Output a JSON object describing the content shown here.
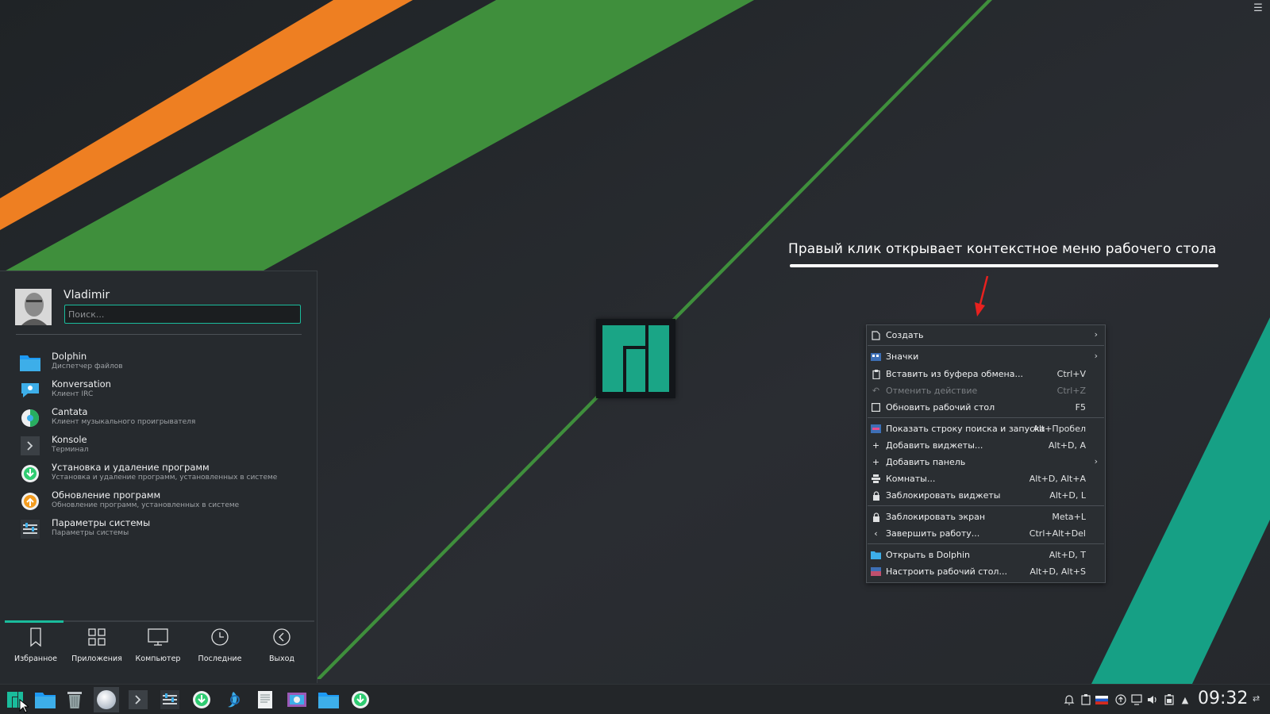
{
  "annotation": {
    "text": "Правый клик открывает контекстное меню рабочего стола"
  },
  "context_menu": {
    "items": [
      {
        "icon": "new-file-icon",
        "label": "Создать",
        "shortcut": "",
        "submenu": true,
        "disabled": false
      },
      {
        "icon": "icons-view-icon",
        "label": "Значки",
        "shortcut": "",
        "submenu": true,
        "disabled": false
      },
      {
        "icon": "clipboard-icon",
        "label": "Вставить из буфера обмена...",
        "shortcut": "Ctrl+V",
        "submenu": false,
        "disabled": false
      },
      {
        "icon": "undo-icon",
        "label": "Отменить действие",
        "shortcut": "Ctrl+Z",
        "submenu": false,
        "disabled": true
      },
      {
        "icon": "refresh-icon",
        "label": "Обновить рабочий стол",
        "shortcut": "F5",
        "submenu": false,
        "disabled": false
      },
      {
        "icon": "krunner-icon",
        "label": "Показать строку поиска и запуска",
        "shortcut": "Alt+Пробел",
        "submenu": false,
        "disabled": false
      },
      {
        "icon": "plus-icon",
        "label": "Добавить виджеты...",
        "shortcut": "Alt+D, A",
        "submenu": false,
        "disabled": false
      },
      {
        "icon": "plus-icon",
        "label": "Добавить панель",
        "shortcut": "",
        "submenu": true,
        "disabled": false
      },
      {
        "icon": "activities-icon",
        "label": "Комнаты...",
        "shortcut": "Alt+D, Alt+A",
        "submenu": false,
        "disabled": false
      },
      {
        "icon": "lock-icon",
        "label": "Заблокировать виджеты",
        "shortcut": "Alt+D, L",
        "submenu": false,
        "disabled": false
      },
      {
        "icon": "lock-icon",
        "label": "Заблокировать экран",
        "shortcut": "Meta+L",
        "submenu": false,
        "disabled": false
      },
      {
        "icon": "chevron-left-icon",
        "label": "Завершить работу...",
        "shortcut": "Ctrl+Alt+Del",
        "submenu": false,
        "disabled": false
      },
      {
        "icon": "folder-icon",
        "label": "Открыть в Dolphin",
        "shortcut": "Alt+D, T",
        "submenu": false,
        "disabled": false
      },
      {
        "icon": "desktop-settings-icon",
        "label": "Настроить рабочий стол...",
        "shortcut": "Alt+D, Alt+S",
        "submenu": false,
        "disabled": false
      }
    ]
  },
  "launcher": {
    "username": "Vladimir",
    "search_placeholder": "Поиск...",
    "favorites": [
      {
        "icon": "folder-icon",
        "name": "Dolphin",
        "description": "Диспетчер файлов"
      },
      {
        "icon": "konversation-icon",
        "name": "Konversation",
        "description": "Клиент IRC"
      },
      {
        "icon": "cantata-icon",
        "name": "Cantata",
        "description": "Клиент музыкального проигрывателя"
      },
      {
        "icon": "terminal-icon",
        "name": "Konsole",
        "description": "Терминал"
      },
      {
        "icon": "software-install-icon",
        "name": "Установка и удаление программ",
        "description": "Установка и удаление программ, установленных в системе"
      },
      {
        "icon": "software-update-icon",
        "name": "Обновление программ",
        "description": "Обновление программ, установленных в системе"
      },
      {
        "icon": "system-settings-icon",
        "name": "Параметры системы",
        "description": "Параметры системы"
      }
    ],
    "tabs": [
      {
        "icon": "bookmark-icon",
        "label": "Избранное",
        "active": true
      },
      {
        "icon": "applications-grid-icon",
        "label": "Приложения",
        "active": false
      },
      {
        "icon": "computer-icon",
        "label": "Компьютер",
        "active": false
      },
      {
        "icon": "history-icon",
        "label": "Последние",
        "active": false
      },
      {
        "icon": "leave-icon",
        "label": "Выход",
        "active": false
      }
    ]
  },
  "panel": {
    "tasks": [
      "manjaro-menu-icon",
      "dolphin-icon",
      "trash-icon",
      "browser-icon",
      "terminal-icon",
      "system-settings-icon",
      "software-install-icon",
      "steam-icon",
      "text-editor-icon",
      "screenshot-icon",
      "folder-icon",
      "software-update-icon"
    ],
    "tray": [
      "notifications-icon",
      "clipboard-icon",
      "keyboard-layout-icon",
      "updates-icon",
      "network-icon",
      "volume-icon",
      "battery-icon",
      "show-hidden-icon"
    ],
    "clock": "09:32"
  },
  "colors": {
    "accent": "#1abc9c",
    "stripe_orange": "#ee7f22",
    "stripe_green": "#3f8f3c",
    "stripe_teal": "#16a085",
    "background": "#1e2226"
  }
}
